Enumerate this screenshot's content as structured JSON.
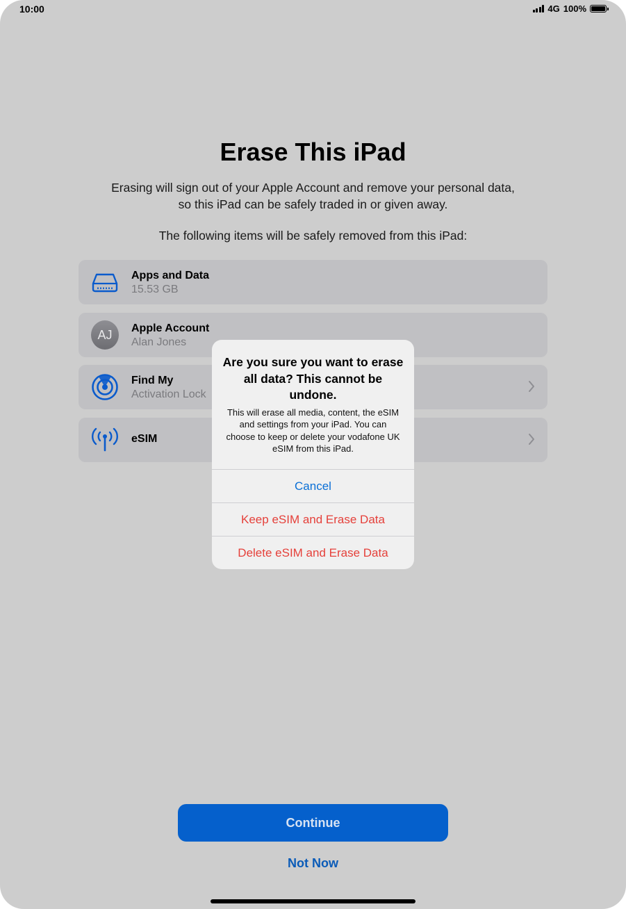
{
  "status_bar": {
    "time": "10:00",
    "network": "4G",
    "battery_percent": "100%",
    "battery_level": 1.0
  },
  "page": {
    "title": "Erase This iPad",
    "description": "Erasing will sign out of your Apple Account and remove your personal data, so this iPad can be safely traded in or given away.",
    "subheading": "The following items will be safely removed from this iPad:"
  },
  "items": [
    {
      "title": "Apps and Data",
      "subtitle": "15.53 GB",
      "icon": "storage-drive-icon"
    },
    {
      "title": "Apple Account",
      "subtitle": "Alan Jones",
      "avatar_initials": "AJ"
    },
    {
      "title": "Find My",
      "subtitle": "Activation Lock",
      "icon": "find-my-icon"
    },
    {
      "title": "eSIM",
      "icon": "antenna-icon"
    }
  ],
  "alert": {
    "title": "Are you sure you want to erase all data? This cannot be undone.",
    "message": "This will erase all media, content, the eSIM and settings from your iPad. You can choose to keep or delete your vodafone UK eSIM from this iPad.",
    "cancel_label": "Cancel",
    "keep_label": "Keep eSIM and Erase Data",
    "delete_label": "Delete eSIM and Erase Data"
  },
  "footer": {
    "continue_label": "Continue",
    "not_now_label": "Not Now"
  },
  "colors": {
    "background": "#cdcdcd",
    "accent_blue": "#0560cc",
    "destructive_red": "#e5403a",
    "icon_blue": "#0a5bcc"
  }
}
